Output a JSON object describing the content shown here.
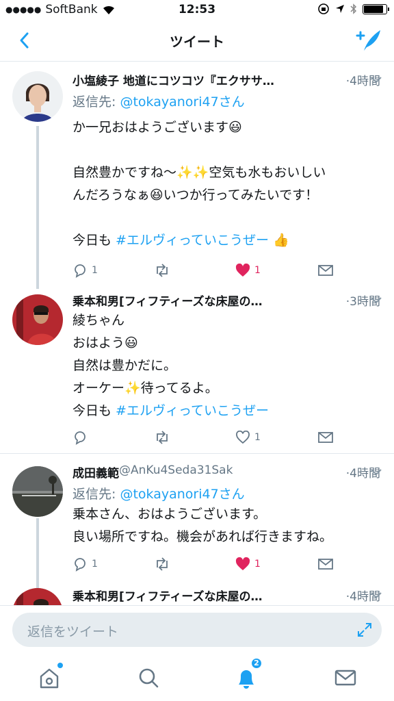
{
  "status_bar": {
    "carrier": "SoftBank",
    "time": "12:53"
  },
  "nav": {
    "title": "ツイート"
  },
  "tweets": [
    {
      "name": "小塩綾子 地道にコツコツ『エクササ…",
      "handle": "",
      "time": "·4時間",
      "reply_prefix": "返信先: ",
      "reply_mention": "@tokayanori47さん",
      "lines": [
        "か一兄おはようございます😃",
        "",
        "自然豊かですね〜✨✨空気も水もおいしい",
        "んだろうなぁ😆いつか行ってみたいです！",
        ""
      ],
      "last_line_prefix": "今日も ",
      "hashtag": "#エルヴィっていこうぜー",
      "last_line_suffix": " 👍",
      "replies": "1",
      "likes": "1",
      "liked": true
    },
    {
      "name": "乗本和男[フィフティーズな床屋の…",
      "handle": "",
      "time": "·3時間",
      "lines": [
        "綾ちゃん",
        "おはよう😃",
        "自然は豊かだに。",
        "オーケー✨待ってるよ。"
      ],
      "last_line_prefix": "今日も ",
      "hashtag": "#エルヴィっていこうぜー",
      "last_line_suffix": "",
      "replies": "",
      "likes": "1",
      "liked": false
    },
    {
      "name": "成田義範",
      "handle": " @AnKu4Seda31Sak",
      "time": "·4時間",
      "reply_prefix": "返信先: ",
      "reply_mention": "@tokayanori47さん",
      "lines": [
        "乗本さん、おはようございます。",
        "良い場所ですね。機会があれば行きますね。"
      ],
      "replies": "1",
      "likes": "1",
      "liked": true
    },
    {
      "name": "乗本和男[フィフティーズな床屋の…",
      "handle": "",
      "time": "·4時間"
    }
  ],
  "composer": {
    "placeholder": "返信をツイート"
  },
  "tab_bar": {
    "notifications_badge": "2"
  },
  "colors": {
    "accent": "#1da1f2",
    "like": "#e0245e",
    "secondary_text": "#657786",
    "divider": "#e1e8ed"
  }
}
